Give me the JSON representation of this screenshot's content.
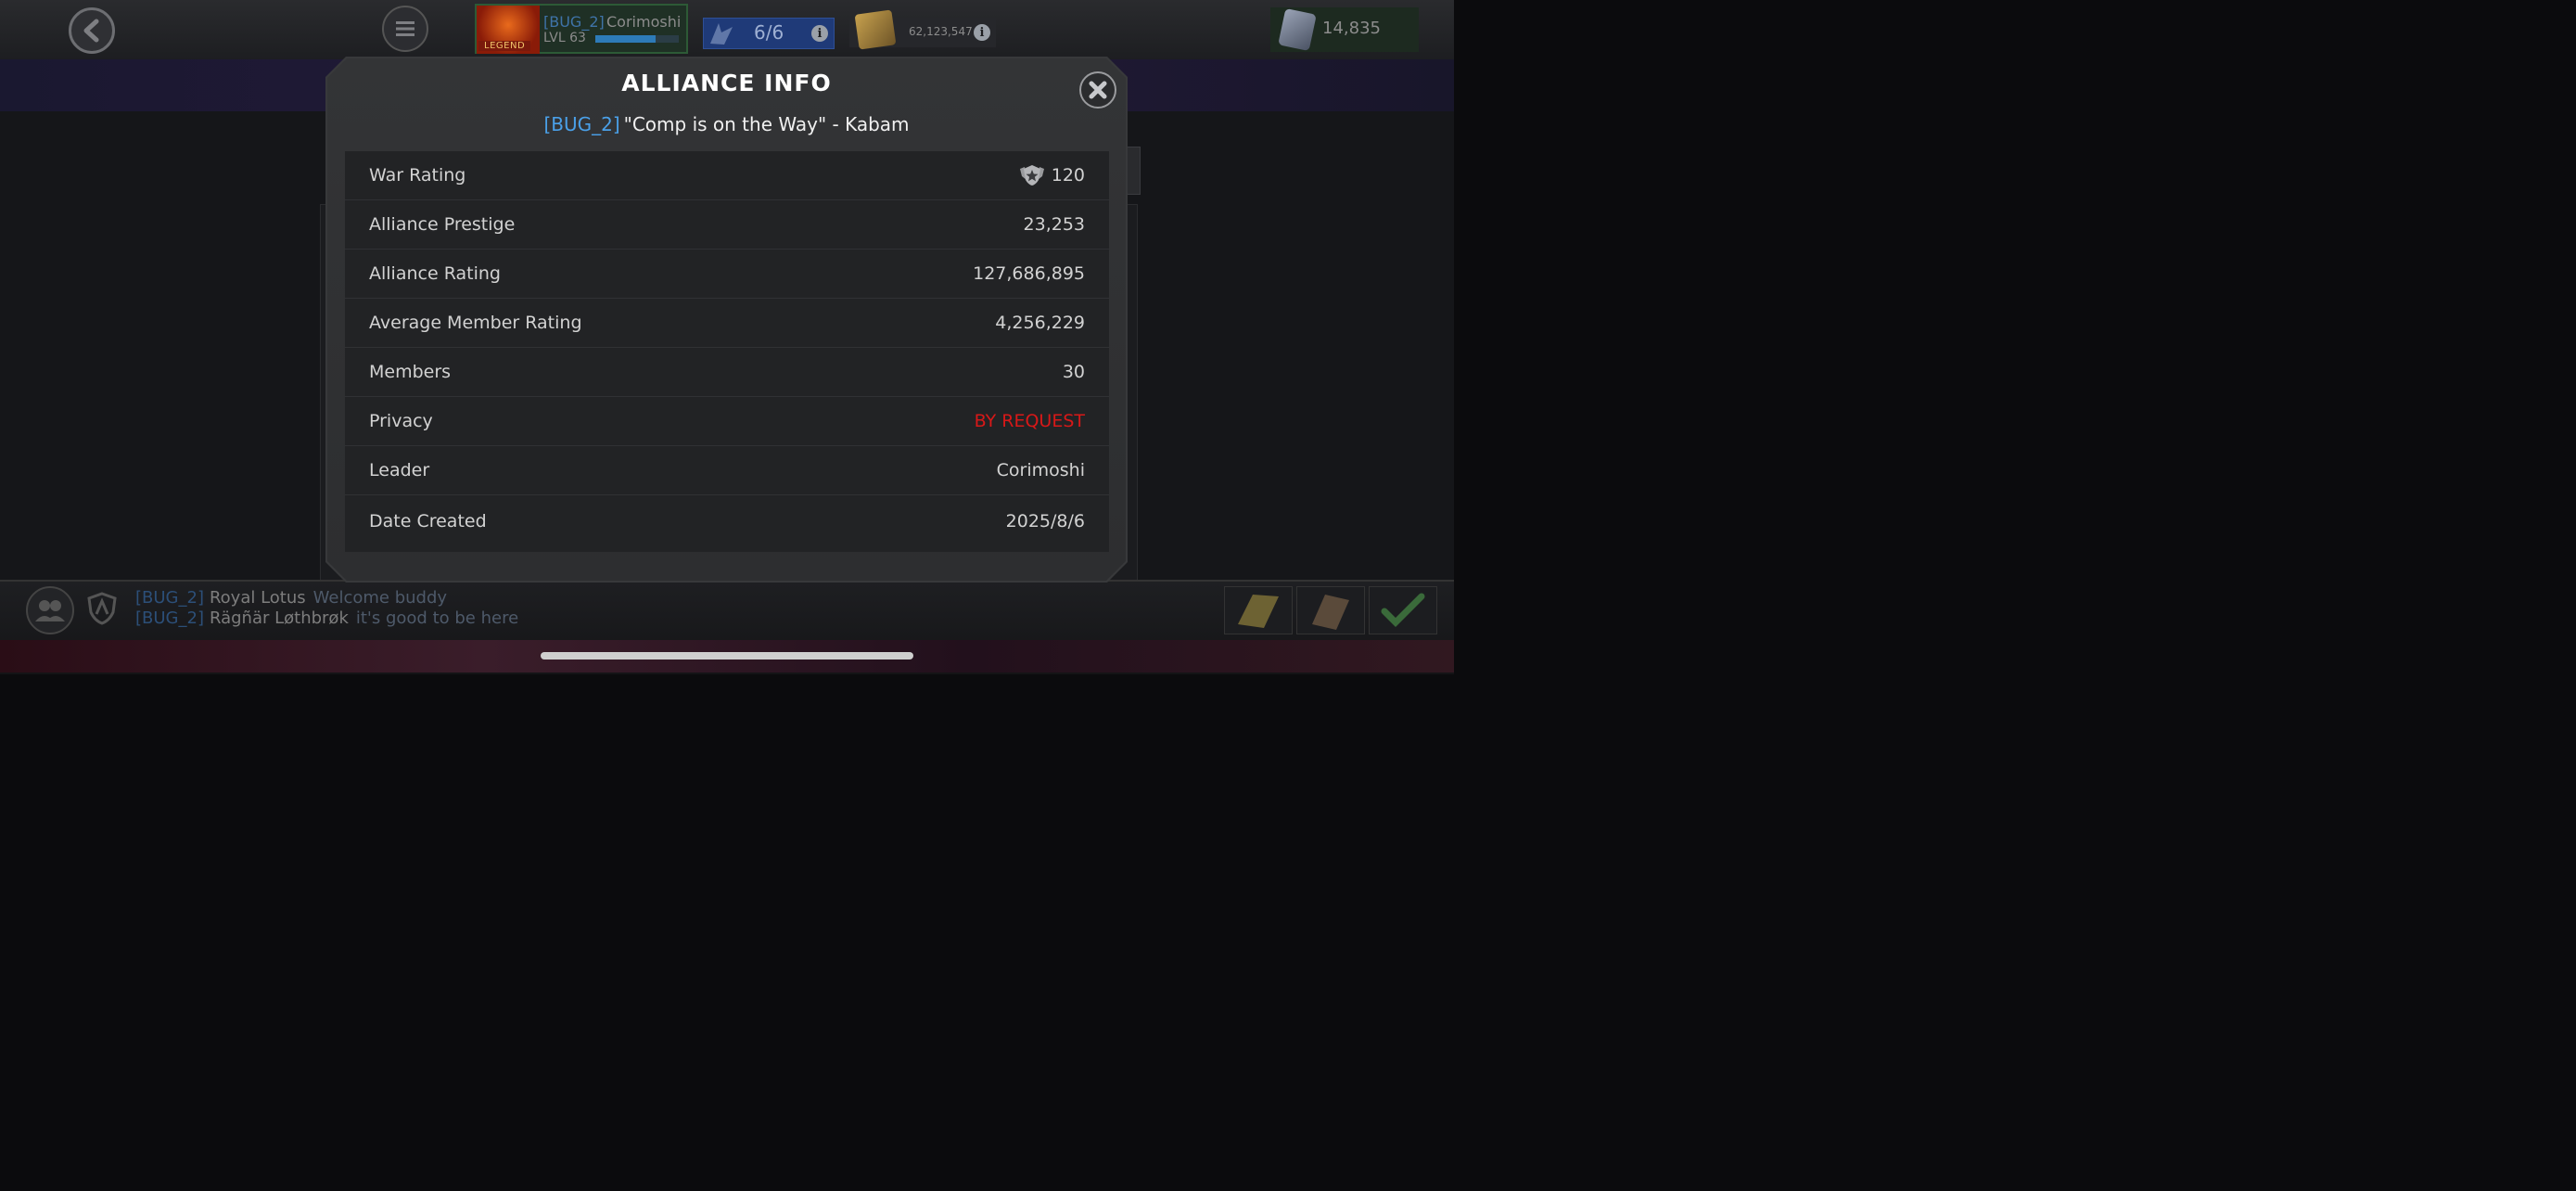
{
  "topbar": {
    "profile": {
      "tag": "[BUG_2]",
      "name": "Corimoshi",
      "level_label": "LVL 63",
      "badge": "LEGEND",
      "xp_fraction": 0.72
    },
    "energy": "6/6",
    "gold": "62,123,547",
    "units": "14,835"
  },
  "modal": {
    "title": "ALLIANCE INFO",
    "alliance_tag": "[BUG_2]",
    "alliance_name": "\"Comp is on the Way\" - Kabam",
    "rows": [
      {
        "label": "War Rating",
        "value": "120"
      },
      {
        "label": "Alliance Prestige",
        "value": "23,253"
      },
      {
        "label": "Alliance Rating",
        "value": "127,686,895"
      },
      {
        "label": "Average Member Rating",
        "value": "4,256,229"
      },
      {
        "label": "Members",
        "value": "30"
      },
      {
        "label": "Privacy",
        "value": "BY REQUEST"
      },
      {
        "label": "Leader",
        "value": "Corimoshi"
      },
      {
        "label": "Date Created",
        "value": "2025/8/6"
      }
    ]
  },
  "chat": [
    {
      "tag": "[BUG_2]",
      "user": "Royal Lotus",
      "message": "Welcome buddy"
    },
    {
      "tag": "[BUG_2]",
      "user": "Rägñär Løthbrøk",
      "message": "it's good to be here"
    }
  ],
  "colors": {
    "tag_blue": "#4aa0e8",
    "privacy_red": "#d81818",
    "modal_bg": "#2d2e30"
  },
  "icons": {
    "back": "chevron-left-icon",
    "menu": "hamburger-menu-icon",
    "close": "close-icon",
    "war_rating": "war-rating-emblem-icon",
    "info": "info-icon"
  }
}
